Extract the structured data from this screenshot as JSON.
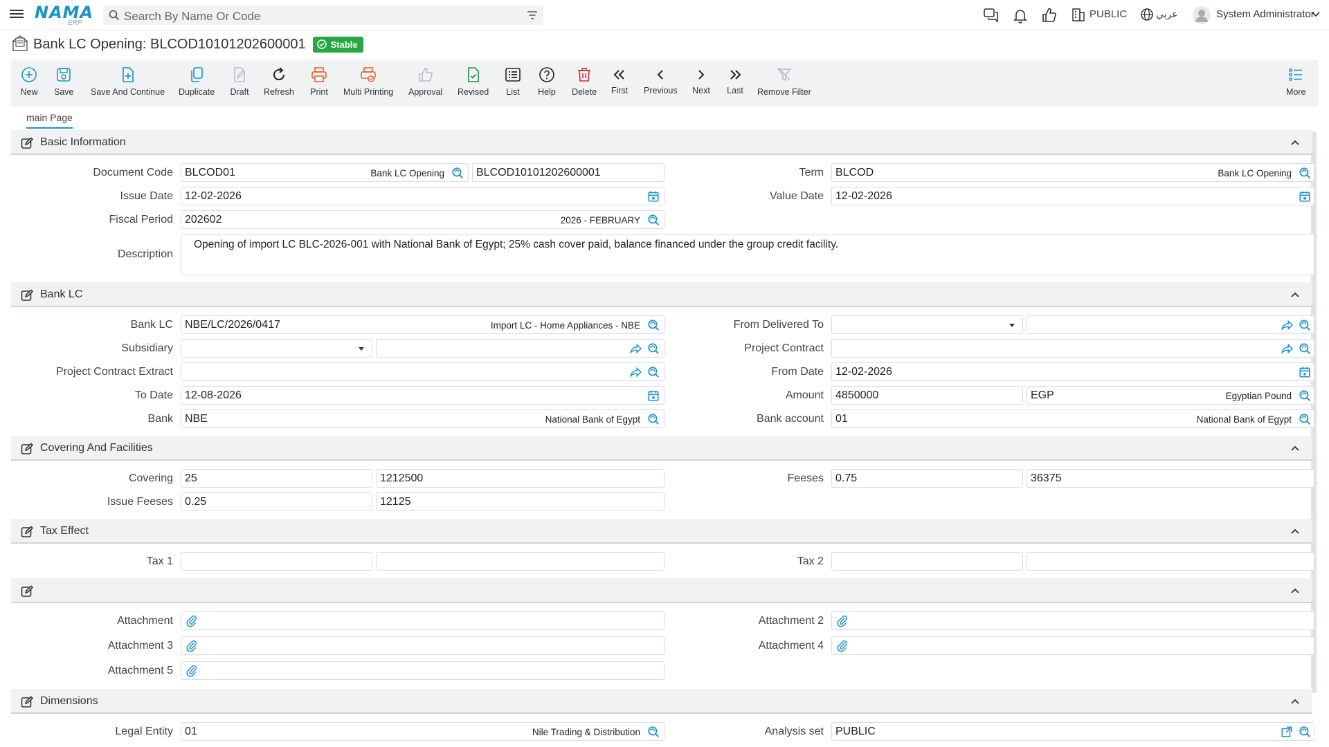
{
  "header": {
    "logo_text": "NAMA",
    "logo_sub": "ERP",
    "search_placeholder": "Search By Name Or Code",
    "company": "PUBLIC",
    "language": "عربي",
    "user": "System Administrator"
  },
  "page": {
    "title": "Bank LC Opening: BLCOD10101202600001",
    "status": "Stable",
    "status_color": "#27a844",
    "accent": "#1a93c9"
  },
  "toolbar": {
    "new": "New",
    "save": "Save",
    "save_continue": "Save And Continue",
    "duplicate": "Duplicate",
    "draft": "Draft",
    "refresh": "Refresh",
    "print": "Print",
    "multi_printing": "Multi Printing",
    "approval": "Approval",
    "revised": "Revised",
    "list": "List",
    "help": "Help",
    "delete": "Delete",
    "first": "First",
    "previous": "Previous",
    "next": "Next",
    "last": "Last",
    "remove_filter": "Remove Filter",
    "more": "More"
  },
  "tabs": {
    "main": "main Page"
  },
  "basic": {
    "title": "Basic Information",
    "document_code_label": "Document Code",
    "document_code": "BLCOD01",
    "document_code_desc": "Bank LC Opening",
    "document_number": "BLCOD10101202600001",
    "term_label": "Term",
    "term": "BLCOD",
    "term_desc": "Bank LC Opening",
    "issue_date_label": "Issue Date",
    "issue_date": "12-02-2026",
    "value_date_label": "Value Date",
    "value_date": "12-02-2026",
    "fiscal_period_label": "Fiscal Period",
    "fiscal_period": "202602",
    "fiscal_period_desc": "2026 - FEBRUARY",
    "description_label": "Description",
    "description": "Opening of import LC BLC-2026-001 with National Bank of Egypt; 25% cash cover paid, balance financed under the group credit facility."
  },
  "bank_lc": {
    "title": "Bank LC",
    "bank_lc_label": "Bank LC",
    "bank_lc": "NBE/LC/2026/0417",
    "bank_lc_desc": "Import LC - Home Appliances - NBE",
    "from_delivered_to_label": "From Delivered To",
    "subsidiary_label": "Subsidiary",
    "project_contract_label": "Project Contract",
    "project_contract_extract_label": "Project Contract Extract",
    "from_date_label": "From Date",
    "from_date": "12-02-2026",
    "to_date_label": "To Date",
    "to_date": "12-08-2026",
    "amount_label": "Amount",
    "amount": "4850000",
    "currency": "EGP",
    "currency_desc": "Egyptian Pound",
    "bank_label": "Bank",
    "bank": "NBE",
    "bank_desc": "National Bank of Egypt",
    "bank_account_label": "Bank account",
    "bank_account": "01",
    "bank_account_desc": "National Bank of Egypt"
  },
  "covering": {
    "title": "Covering And Facilities",
    "covering_label": "Covering",
    "covering_pct": "25",
    "covering_amount": "1212500",
    "feeses_label": "Feeses",
    "feeses_pct": "0.75",
    "feeses_amount": "36375",
    "issue_feeses_label": "Issue Feeses",
    "issue_feeses_pct": "0.25",
    "issue_feeses_amount": "12125"
  },
  "tax": {
    "title": "Tax Effect",
    "tax1_label": "Tax 1",
    "tax2_label": "Tax 2"
  },
  "attachments": {
    "title": "",
    "a1_label": "Attachment",
    "a2_label": "Attachment 2",
    "a3_label": "Attachment 3",
    "a4_label": "Attachment 4",
    "a5_label": "Attachment 5"
  },
  "dimensions": {
    "title": "Dimensions",
    "legal_entity_label": "Legal Entity",
    "legal_entity": "01",
    "legal_entity_desc": "Nile Trading & Distribution",
    "analysis_set_label": "Analysis set",
    "analysis_set": "PUBLIC"
  }
}
